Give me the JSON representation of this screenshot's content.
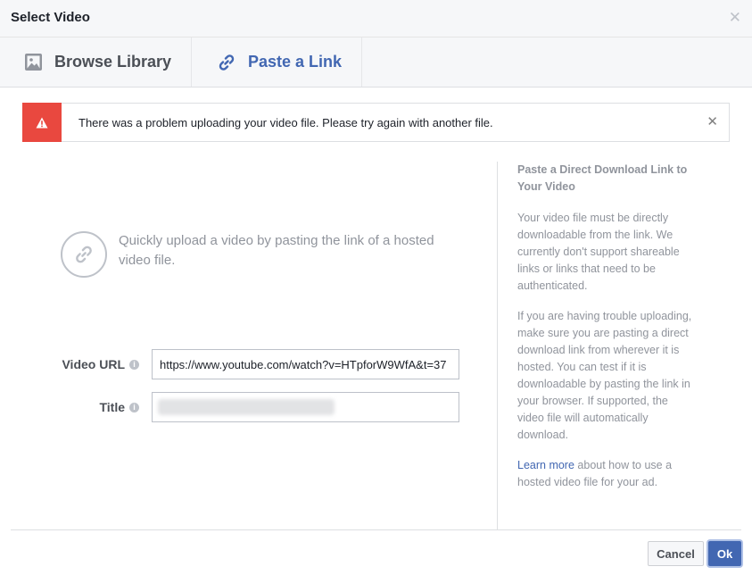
{
  "dialog": {
    "title": "Select Video"
  },
  "tabs": [
    {
      "label": "Browse Library",
      "icon": "image-icon"
    },
    {
      "label": "Paste a Link",
      "icon": "link-icon"
    }
  ],
  "alert": {
    "message": "There was a problem uploading your video file. Please try again with another file.",
    "color": "#e9483f"
  },
  "hero": {
    "text": "Quickly upload a video by pasting the link of a hosted video file."
  },
  "form": {
    "video_url_label": "Video URL",
    "video_url_value": "https://www.youtube.com/watch?v=HTpforW9WfA&t=37",
    "title_label": "Title"
  },
  "sidebar": {
    "heading": "Paste a Direct Download Link to Your Video",
    "para1": "Your video file must be directly downloadable from the link. We currently don't support shareable links or links that need to be authenticated.",
    "para2": "If you are having trouble uploading, make sure you are pasting a direct download link from wherever it is hosted. You can test if it is downloadable by pasting the link in your browser. If supported, the video file will automatically download.",
    "learn_more": "Learn more",
    "learn_more_rest": " about how to use a hosted video file for your ad."
  },
  "buttons": {
    "cancel": "Cancel",
    "ok": "Ok"
  },
  "colors": {
    "accent": "#4267b2",
    "error": "#e9483f"
  }
}
